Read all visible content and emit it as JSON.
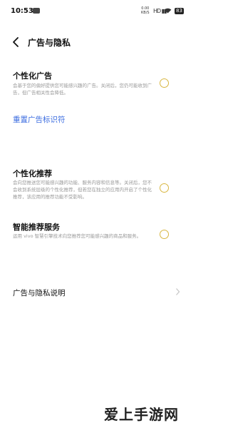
{
  "status_bar": {
    "time": "10:53",
    "net_speed_value": "0.00",
    "net_speed_unit": "KB/S",
    "signal": "HD",
    "battery": "83"
  },
  "header": {
    "title": "广告与隐私"
  },
  "personalized_ads": {
    "title": "个性化广告",
    "description": "会基于您的偏好提供您可能感兴趣的广告。关闭后，您仍可能收到广告，但广告相关性会降低。",
    "selected": false
  },
  "reset_ad_id": {
    "label": "重置广告标识符"
  },
  "personalized_recommend": {
    "title": "个性化推荐",
    "description": "会向您推送您可能感兴趣的功能、服务内容和信息等。关闭后，您不会收到系统层级的个性化推荐，但若您在独立的应用内开启了个性化推荐，该应用的推荐功能不受影响。",
    "selected": false
  },
  "smart_recommend": {
    "title": "智能推荐服务",
    "description": "运用 vivo 智慧引擎技术向您推荐您可能感兴趣的商品和服务。",
    "selected": false
  },
  "privacy_statement": {
    "label": "广告与隐私说明"
  },
  "watermark": {
    "text": "爱上手游网"
  },
  "colors": {
    "accent_link": "#3d6ee0",
    "radio_border": "#d8b640"
  }
}
